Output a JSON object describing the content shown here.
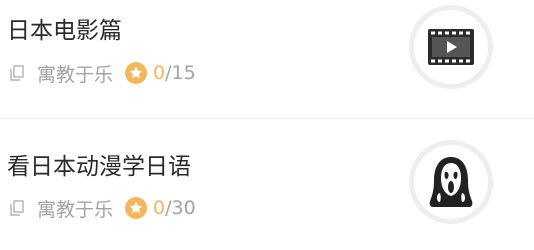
{
  "courses": [
    {
      "title": "日本电影篇",
      "source": "寓教于乐",
      "progress": {
        "done": "0",
        "total": "/15"
      },
      "thumbnail_icon": "film-video-icon"
    },
    {
      "title": "看日本动漫学日语",
      "source": "寓教于乐",
      "progress": {
        "done": "0",
        "total": "/30"
      },
      "thumbnail_icon": "ghost-mask-icon"
    }
  ],
  "colors": {
    "title_text": "#2a2a2a",
    "meta_text": "#a3a3a3",
    "progress_accent": "#f2b75b",
    "divider": "#ececec",
    "thumb_ring": "#eeeeee"
  }
}
